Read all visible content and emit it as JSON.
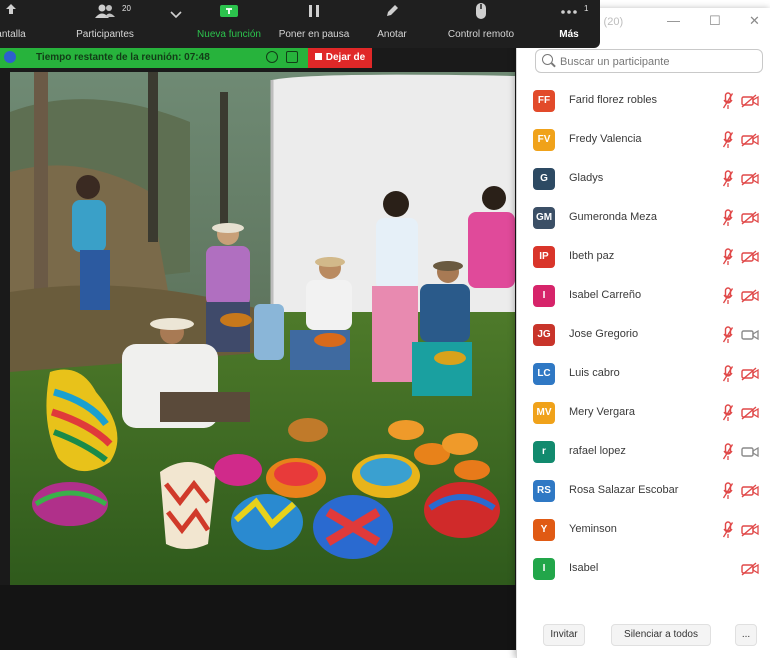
{
  "toolbar": {
    "partial_left_label": "antalla",
    "participants_label": "Participantes",
    "participants_count": "20",
    "new_feature_label": "Nueva función",
    "new_feature_icon": "puzzle-icon",
    "pause_label": "Poner en pausa",
    "annotate_label": "Anotar",
    "remote_label": "Control remoto",
    "more_label": "Más",
    "more_badge": "1"
  },
  "timer": {
    "text": "Tiempo restante de la reunión: 07:48",
    "leave_label": "Dejar de"
  },
  "panel": {
    "title_partial": "s (20)",
    "search_placeholder": "Buscar un participante",
    "participants": [
      {
        "initials": "FF",
        "name": "Farid florez robles",
        "color": "#e24a2a",
        "mic_muted": true,
        "cam_off": true
      },
      {
        "initials": "FV",
        "name": "Fredy Valencia",
        "color": "#f0a21a",
        "mic_muted": true,
        "cam_off": true
      },
      {
        "initials": "G",
        "name": "Gladys",
        "color": "#2d4a63",
        "mic_muted": true,
        "cam_off": true
      },
      {
        "initials": "GM",
        "name": "Gumeronda Meza",
        "color": "#3b4f66",
        "mic_muted": true,
        "cam_off": true
      },
      {
        "initials": "IP",
        "name": "Ibeth paz",
        "color": "#d9352a",
        "mic_muted": true,
        "cam_off": true
      },
      {
        "initials": "I",
        "name": "Isabel Carreño",
        "color": "#d6246a",
        "mic_muted": true,
        "cam_off": true
      },
      {
        "initials": "JG",
        "name": "Jose Gregorio",
        "color": "#c8342a",
        "mic_muted": true,
        "cam_off": false
      },
      {
        "initials": "LC",
        "name": "Luis cabro",
        "color": "#2f78c4",
        "mic_muted": true,
        "cam_off": true
      },
      {
        "initials": "MV",
        "name": "Mery Vergara",
        "color": "#f0a21a",
        "mic_muted": true,
        "cam_off": true
      },
      {
        "initials": "r",
        "name": "rafael lopez",
        "color": "#128a6e",
        "mic_muted": true,
        "cam_off": false
      },
      {
        "initials": "RS",
        "name": "Rosa Salazar Escobar",
        "color": "#2f78c4",
        "mic_muted": true,
        "cam_off": true
      },
      {
        "initials": "Y",
        "name": "Yeminson",
        "color": "#e05a14",
        "mic_muted": true,
        "cam_off": true
      },
      {
        "initials": "I",
        "name": "Isabel",
        "color": "#22a64a",
        "mic_muted": false,
        "cam_off": true
      }
    ],
    "invite_label": "Invitar",
    "mute_all_label": "Silenciar a todos",
    "more_label": "..."
  }
}
